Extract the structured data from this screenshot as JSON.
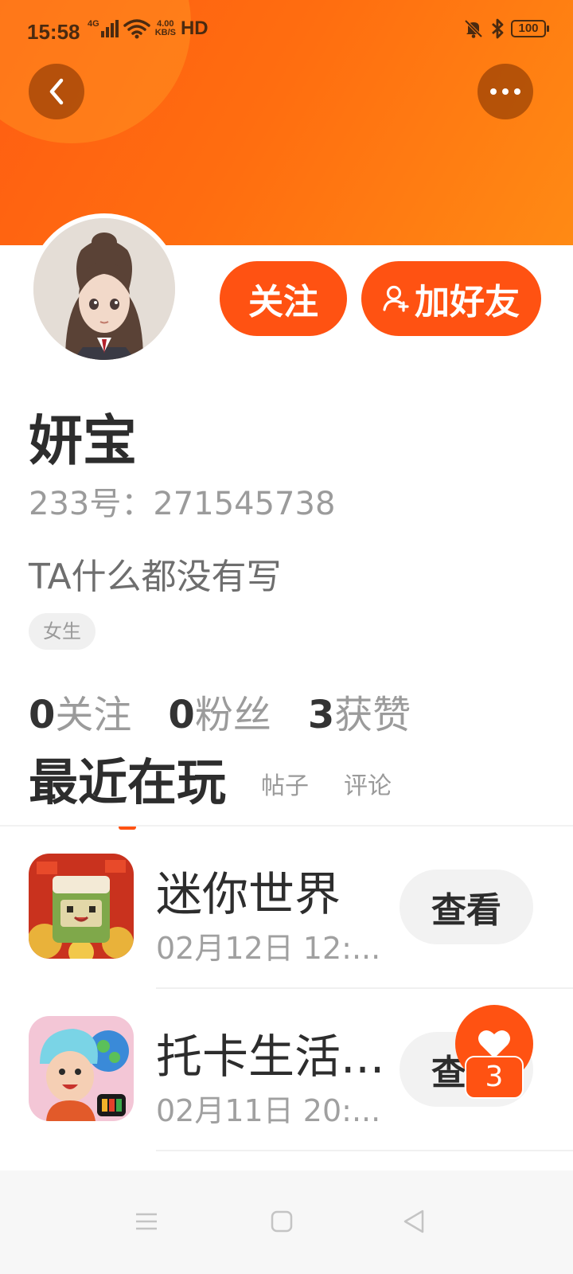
{
  "status_bar": {
    "time": "15:58",
    "network_type": "4G",
    "speed_value": "4.00",
    "speed_unit": "KB/S",
    "hd": "HD",
    "battery": "100"
  },
  "profile": {
    "nickname": "妍宝",
    "id_text": "233号：271545738",
    "bio": "TA什么都没有写",
    "gender": "女生",
    "follow_button": "关注",
    "add_friend_button": "加好友"
  },
  "stats": [
    {
      "count": "0",
      "label": "关注"
    },
    {
      "count": "0",
      "label": "粉丝"
    },
    {
      "count": "3",
      "label": "获赞"
    }
  ],
  "tabs": {
    "active": "最近在玩",
    "posts": "帖子",
    "comments": "评论"
  },
  "games": [
    {
      "name": "迷你世界",
      "time": "02月12日 12:...",
      "button": "查看"
    },
    {
      "name": "托卡生活...",
      "time": "02月11日 20:...",
      "button": "查看"
    }
  ],
  "like_badge": {
    "count": "3"
  },
  "colors": {
    "accent": "#ff5212",
    "header_start": "#ff5d12",
    "header_end": "#ff8a14"
  },
  "icons": {
    "back": "chevron-left-icon",
    "more": "more-dots-icon",
    "add_friend": "add-user-icon",
    "like": "heart-icon",
    "nav_menu": "menu-icon",
    "nav_home": "square-icon",
    "nav_back": "triangle-back-icon"
  }
}
